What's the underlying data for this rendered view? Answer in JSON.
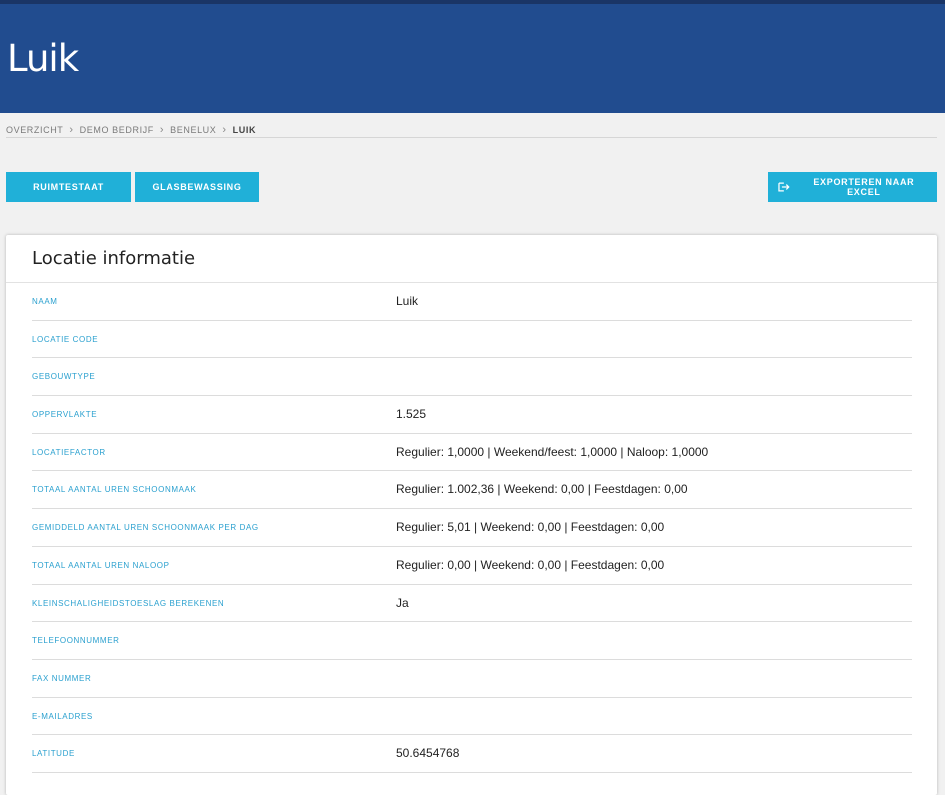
{
  "page": {
    "title": "Luik"
  },
  "breadcrumb": {
    "items": [
      "OVERZICHT",
      "DEMO BEDRIJF",
      "BENELUX"
    ],
    "current": "LUIK"
  },
  "toolbar": {
    "ruimtestaat_label": "RUIMTESTAAT",
    "glasbewassing_label": "GLASBEWASSING",
    "export_label": "EXPORTEREN NAAR EXCEL",
    "export_icon": "export-icon"
  },
  "card": {
    "title": "Locatie informatie",
    "fields": [
      {
        "label": "NAAM",
        "value": "Luik"
      },
      {
        "label": "LOCATIE CODE",
        "value": ""
      },
      {
        "label": "GEBOUWTYPE",
        "value": ""
      },
      {
        "label": "OPPERVLAKTE",
        "value": "1.525"
      },
      {
        "label": "LOCATIEFACTOR",
        "value": "Regulier: 1,0000 | Weekend/feest: 1,0000 | Naloop: 1,0000"
      },
      {
        "label": "TOTAAL AANTAL UREN SCHOONMAAK",
        "value": "Regulier: 1.002,36 | Weekend: 0,00 | Feestdagen: 0,00"
      },
      {
        "label": "GEMIDDELD AANTAL UREN SCHOONMAAK PER DAG",
        "value": "Regulier: 5,01 | Weekend: 0,00 | Feestdagen: 0,00"
      },
      {
        "label": "TOTAAL AANTAL UREN NALOOP",
        "value": "Regulier: 0,00 | Weekend: 0,00 | Feestdagen: 0,00"
      },
      {
        "label": "KLEINSCHALIGHEIDSTOESLAG BEREKENEN",
        "value": "Ja"
      },
      {
        "label": "TELEFOONNUMMER",
        "value": ""
      },
      {
        "label": "FAX NUMMER",
        "value": ""
      },
      {
        "label": "E-MAILADRES",
        "value": ""
      },
      {
        "label": "LATITUDE",
        "value": "50.6454768"
      }
    ]
  },
  "colors": {
    "header_bg": "#214c8f",
    "accent": "#20b0d8",
    "label": "#2aa0cf"
  }
}
